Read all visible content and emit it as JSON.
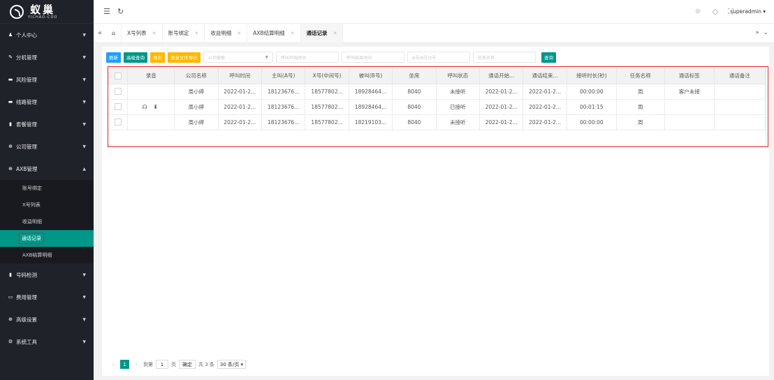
{
  "logo": {
    "cn": "蚁巢",
    "en": "YICHAO-COO"
  },
  "sidebar": {
    "items": [
      {
        "label": "个人中心",
        "icon": "user-icon"
      },
      {
        "label": "分机管理",
        "icon": "wrench-icon"
      },
      {
        "label": "风险管理",
        "icon": "monitor-icon"
      },
      {
        "label": "线路管理",
        "icon": "monitor-icon"
      },
      {
        "label": "套餐管理",
        "icon": "book-icon"
      },
      {
        "label": "公司管理",
        "icon": "globe-icon"
      },
      {
        "label": "AXB管理",
        "icon": "globe-icon"
      },
      {
        "label": "号码检测",
        "icon": "book-icon"
      },
      {
        "label": "费用管理",
        "icon": "card-icon"
      },
      {
        "label": "高级设置",
        "icon": "globe-icon"
      },
      {
        "label": "系统工具",
        "icon": "gears-icon"
      }
    ],
    "axb_sub": [
      "账号绑定",
      "X号列表",
      "收益明细",
      "通话记录",
      "AXB结算明细"
    ]
  },
  "header": {
    "username": "superadmin"
  },
  "tabs": [
    {
      "label": "X号列表"
    },
    {
      "label": "账号绑定"
    },
    {
      "label": "收益明细"
    },
    {
      "label": "AXB结算明细"
    },
    {
      "label": "通话记录"
    }
  ],
  "toolbar": {
    "refresh": "刷新",
    "advanced_search": "高级查询",
    "export": "导出",
    "export_recordings": "录音文件导出",
    "company_placeholder": "公司搜索",
    "call_start_placeholder": "呼叫开始时间",
    "call_end_placeholder": "呼叫结束时间",
    "ab_number_placeholder": "A号/B号/X号",
    "task_name_placeholder": "任务名称",
    "search": "查询"
  },
  "table": {
    "columns": [
      "录音",
      "公司名称",
      "呼叫时间",
      "主叫(A号)",
      "X号(中间号)",
      "被叫(B号)",
      "坐席",
      "呼叫状态",
      "通话开始...",
      "通话结束...",
      "接听时长(秒)",
      "任务名称",
      "通话标签",
      "通话备注"
    ],
    "rows": [
      {
        "recording": "",
        "company": "周小婷",
        "call_time": "2022-01-2...",
        "caller_a": "18123676...",
        "x_number": "18577802...",
        "callee_b": "18928464...",
        "seat": "8040",
        "status": "未接听",
        "start": "2022-01-2...",
        "end": "2022-01-2...",
        "duration": "00:00:00",
        "task": "周",
        "tag": "客户未接",
        "note": ""
      },
      {
        "recording": "☊ ⬇",
        "company": "周小婷",
        "call_time": "2022-01-2...",
        "caller_a": "18123676...",
        "x_number": "18577802...",
        "callee_b": "18928464...",
        "seat": "8040",
        "status": "已接听",
        "start": "2022-01-2...",
        "end": "2022-01-2...",
        "duration": "00:01:15",
        "task": "周",
        "tag": "",
        "note": ""
      },
      {
        "recording": "",
        "company": "周小婷",
        "call_time": "2022-01-2...",
        "caller_a": "18123676...",
        "x_number": "18577802...",
        "callee_b": "18219103...",
        "seat": "8040",
        "status": "未接听",
        "start": "2022-01-2...",
        "end": "2022-01-2...",
        "duration": "00:00:00",
        "task": "周",
        "tag": "",
        "note": ""
      }
    ]
  },
  "pager": {
    "current": "1",
    "goto_label": "到第",
    "goto_value": "1",
    "page_unit": "页",
    "confirm": "确定",
    "total": "共 3 条",
    "page_size": "30 条/页"
  },
  "colors": {
    "accent": "#009688",
    "blue": "#1e9fff",
    "orange": "#ffb800",
    "highlight": "#e02020",
    "sidebar": "#20222a"
  }
}
